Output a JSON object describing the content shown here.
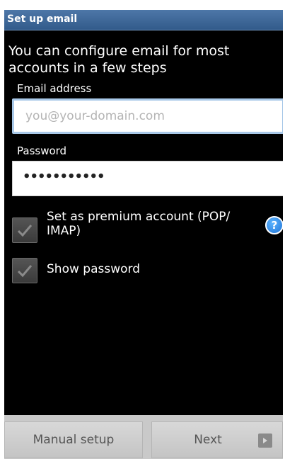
{
  "title_bar": {
    "title": "Set up email"
  },
  "heading": "You can configure email for most accounts in a few steps",
  "email": {
    "label": "Email address",
    "placeholder": "you@your-domain.com",
    "value": ""
  },
  "password": {
    "label": "Password",
    "value": "•••••••••••"
  },
  "options": {
    "premium_label": "Set as premium account (POP/ IMAP)",
    "show_password_label": "Show password",
    "help_glyph": "?"
  },
  "buttons": {
    "manual_setup": "Manual setup",
    "next": "Next"
  },
  "icons": {
    "help": "help-icon",
    "next_arrow": "arrow-right-icon",
    "checkmark": "checkmark-icon"
  },
  "colors": {
    "title_bar": "#325b8a",
    "background": "#000000",
    "help_blue": "#1f74d6",
    "focus_border": "#a8c8e8"
  }
}
